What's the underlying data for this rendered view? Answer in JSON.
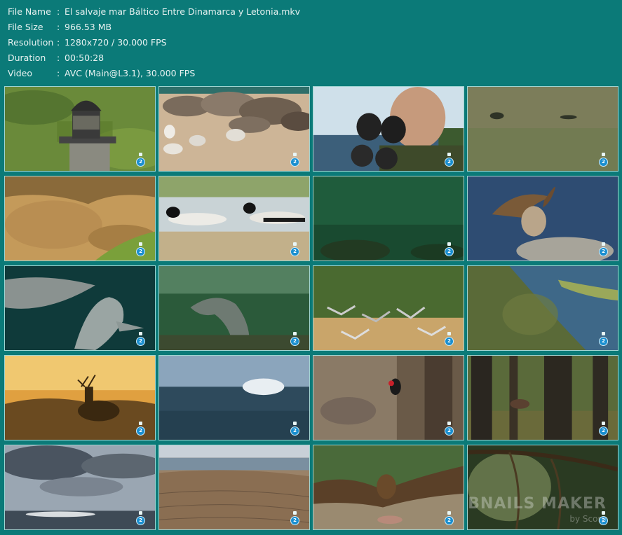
{
  "file_info": [
    {
      "key": "File Name",
      "value": "El salvaje mar Báltico Entre Dinamarca y Letonia.mkv"
    },
    {
      "key": "File Size",
      "value": "966.53 MB"
    },
    {
      "key": "Resolution",
      "value": "1280x720 / 30.000 FPS"
    },
    {
      "key": "Duration",
      "value": "00:50:28"
    },
    {
      "key": "Video",
      "value": "AVC (Main@L3.1), 30.000 FPS"
    }
  ],
  "separator": ":",
  "channel_logo": "2",
  "watermark": {
    "title": "THUMBNAILS MAKER",
    "subtitle": "by Scorp"
  },
  "colors": {
    "background": "#0b7a78",
    "text": "#e7f2f1",
    "thumb_border": "#9fd4d1"
  }
}
